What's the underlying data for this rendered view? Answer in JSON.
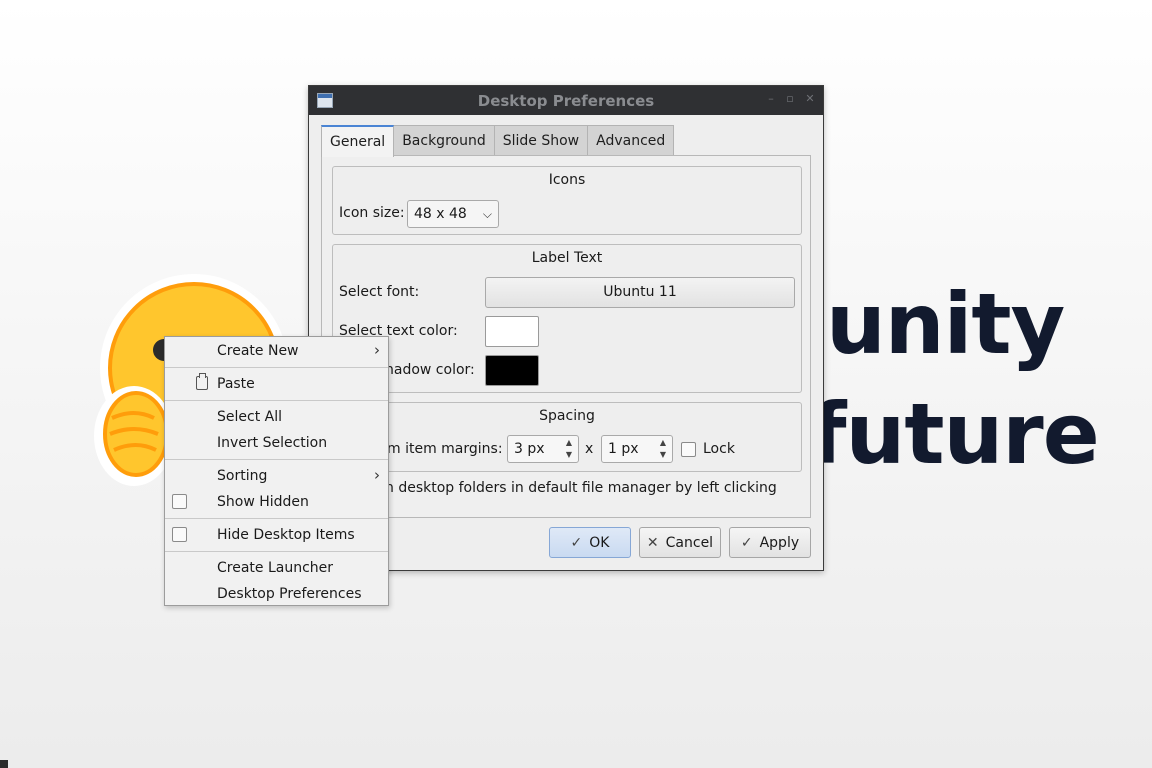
{
  "wallpaper": {
    "line1": "unity",
    "line2": "future"
  },
  "dialog": {
    "title": "Desktop Preferences",
    "tabs": [
      "General",
      "Background",
      "Slide Show",
      "Advanced"
    ],
    "icons": {
      "title": "Icons",
      "icon_size_label": "Icon size:",
      "icon_size_value": "48 x 48"
    },
    "label_text": {
      "title": "Label Text",
      "font_label": "Select font:",
      "font_value": "Ubuntu 11",
      "text_color_label": "Select text color:",
      "text_color": "#ffffff",
      "shadow_color_label": "hadow color:",
      "shadow_color": "#000000"
    },
    "spacing": {
      "title": "Spacing",
      "margins_label": "m item margins:",
      "margin_x": "3 px",
      "times": "x",
      "margin_y": "1 px",
      "lock_label": "Lock"
    },
    "folders_option": "n desktop folders in default file manager by left clicking",
    "buttons": {
      "ok": "OK",
      "cancel": "Cancel",
      "apply": "Apply"
    }
  },
  "context_menu": {
    "create_new": "Create New",
    "paste": "Paste",
    "select_all": "Select All",
    "invert_selection": "Invert Selection",
    "sorting": "Sorting",
    "show_hidden": "Show Hidden",
    "hide_desktop_items": "Hide Desktop Items",
    "create_launcher": "Create Launcher",
    "desktop_preferences": "Desktop Preferences"
  },
  "colors": {
    "accent": "#4a84d4",
    "titlebar": "#2f3033",
    "wallpaper_text": "#121a2e"
  }
}
